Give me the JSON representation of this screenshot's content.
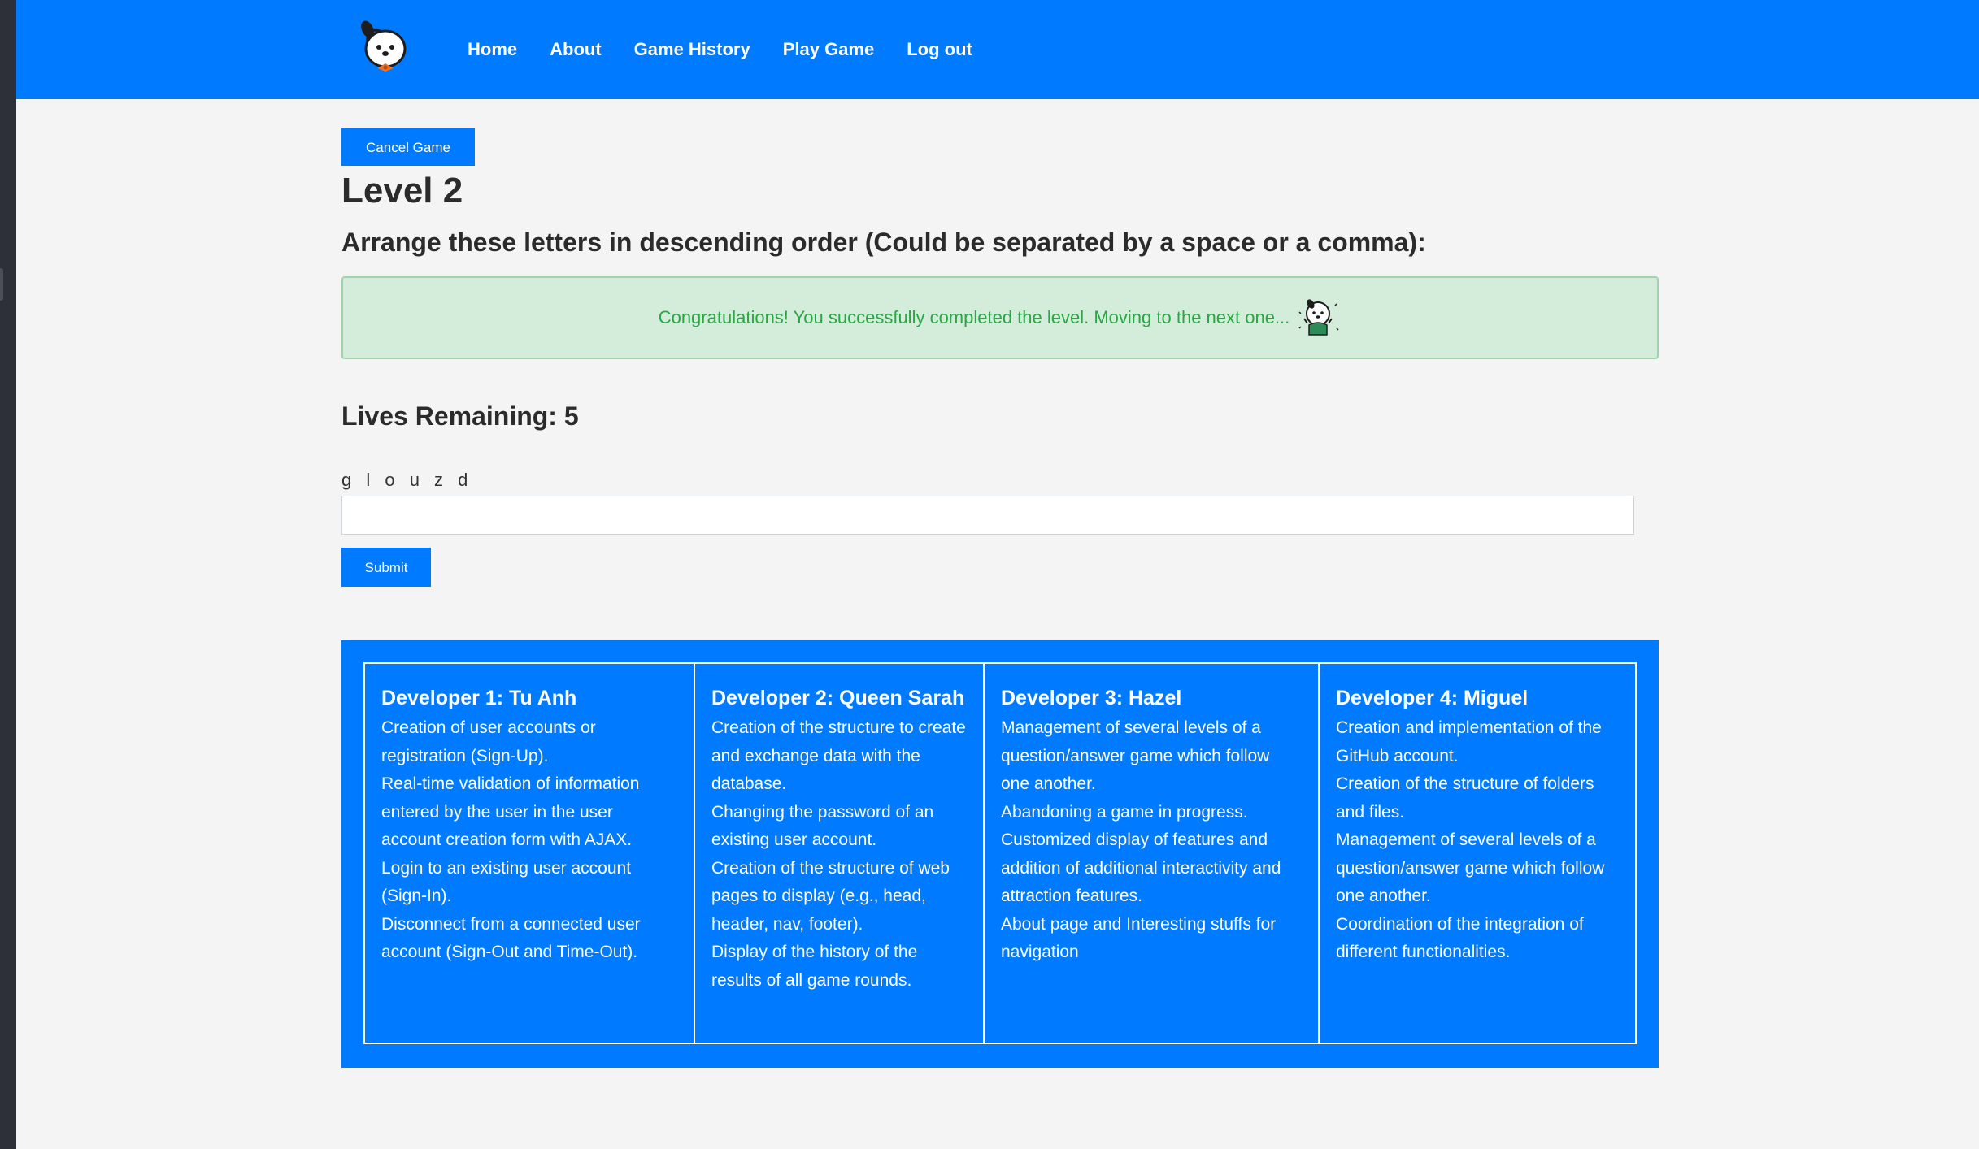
{
  "nav": {
    "links": [
      "Home",
      "About",
      "Game History",
      "Play Game",
      "Log out"
    ]
  },
  "game": {
    "cancel_label": "Cancel Game",
    "level_title": "Level 2",
    "instructions": "Arrange these letters in descending order (Could be separated by a space or a comma):",
    "alert_message": "Congratulations! You successfully completed the level. Moving to the next one...",
    "lives": "Lives Remaining: 5",
    "letters": "g l o u z d",
    "answer_value": "",
    "submit_label": "Submit"
  },
  "developers": [
    {
      "name": "Developer 1: Tu Anh",
      "tasks": [
        "Creation of user accounts or registration (Sign-Up).",
        "Real-time validation of information entered by the user in the user account creation form with AJAX.",
        "Login to an existing user account (Sign-In).",
        "Disconnect from a connected user account (Sign-Out and Time-Out)."
      ]
    },
    {
      "name": "Developer 2: Queen Sarah",
      "tasks": [
        "Creation of the structure to create and exchange data with the database.",
        "Changing the password of an existing user account.",
        "Creation of the structure of web pages to display (e.g., head, header, nav, footer).",
        "Display of the history of the results of all game rounds."
      ]
    },
    {
      "name": "Developer 3: Hazel",
      "tasks": [
        "Management of several levels of a question/answer game which follow one another.",
        "Abandoning a game in progress.",
        "Customized display of features and addition of additional interactivity and attraction features.",
        "About page and Interesting stuffs for navigation"
      ]
    },
    {
      "name": "Developer 4: Miguel",
      "tasks": [
        "Creation and implementation of the GitHub account.",
        "Creation of the structure of folders and files.",
        "Management of several levels of a question/answer game which follow one another.",
        "Coordination of the integration of different functionalities."
      ]
    }
  ],
  "colors": {
    "brand": "#007bff",
    "success_bg": "#d4edda",
    "success_text": "#28a745"
  }
}
